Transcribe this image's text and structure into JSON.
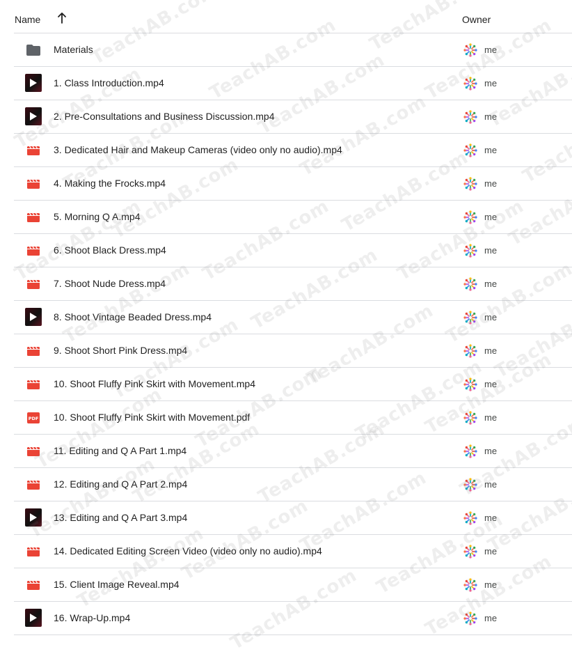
{
  "header": {
    "name_label": "Name",
    "owner_label": "Owner",
    "sort_direction": "ascending"
  },
  "colors": {
    "video_red": "#ea4335",
    "folder_gray": "#5f6368",
    "divider": "#dadce0"
  },
  "files": [
    {
      "name": "Materials",
      "icon": "folder-icon",
      "owner": "me"
    },
    {
      "name": "1. Class Introduction.mp4",
      "icon": "video-thumbnail-icon",
      "owner": "me"
    },
    {
      "name": "2. Pre-Consultations and Business Discussion.mp4",
      "icon": "video-thumbnail-icon",
      "owner": "me"
    },
    {
      "name": "3. Dedicated Hair and Makeup Cameras (video only no audio).mp4",
      "icon": "video-icon",
      "owner": "me"
    },
    {
      "name": "4. Making the Frocks.mp4",
      "icon": "video-icon",
      "owner": "me"
    },
    {
      "name": "5. Morning Q A.mp4",
      "icon": "video-icon",
      "owner": "me"
    },
    {
      "name": "6. Shoot Black Dress.mp4",
      "icon": "video-icon",
      "owner": "me"
    },
    {
      "name": "7. Shoot Nude Dress.mp4",
      "icon": "video-icon",
      "owner": "me"
    },
    {
      "name": "8. Shoot Vintage Beaded Dress.mp4",
      "icon": "video-thumbnail-icon",
      "owner": "me"
    },
    {
      "name": "9. Shoot Short Pink Dress.mp4",
      "icon": "video-icon",
      "owner": "me"
    },
    {
      "name": "10. Shoot Fluffy Pink Skirt with Movement.mp4",
      "icon": "video-icon",
      "owner": "me"
    },
    {
      "name": "10. Shoot Fluffy Pink Skirt with Movement.pdf",
      "icon": "pdf-icon",
      "owner": "me"
    },
    {
      "name": "11. Editing and Q A Part 1.mp4",
      "icon": "video-icon",
      "owner": "me"
    },
    {
      "name": "12. Editing and Q A Part 2.mp4",
      "icon": "video-icon",
      "owner": "me"
    },
    {
      "name": "13. Editing and Q A Part 3.mp4",
      "icon": "video-thumbnail-icon",
      "owner": "me"
    },
    {
      "name": "14. Dedicated Editing Screen Video (video only no audio).mp4",
      "icon": "video-icon",
      "owner": "me"
    },
    {
      "name": "15. Client Image Reveal.mp4",
      "icon": "video-icon",
      "owner": "me"
    },
    {
      "name": "16. Wrap-Up.mp4",
      "icon": "video-thumbnail-icon",
      "owner": "me"
    }
  ],
  "watermark_text": "TeachAB.com"
}
